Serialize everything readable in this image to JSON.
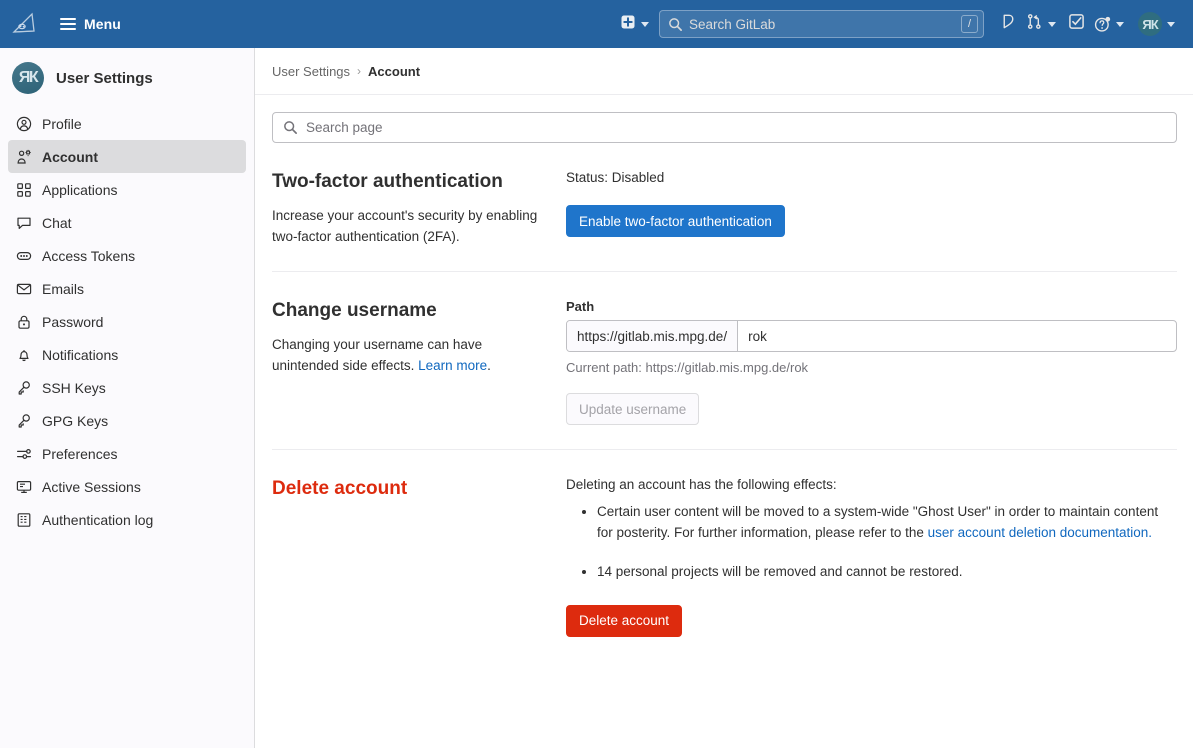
{
  "navbar": {
    "logo_icon": "gitlab-custom-logo-icon",
    "menu_label": "Menu",
    "hamburger_icon": "hamburger-menu-icon",
    "create_new_icon": "plus-square-icon",
    "search": {
      "icon": "search-icon",
      "placeholder": "Search GitLab",
      "value": "",
      "shortcut_badge": "/"
    },
    "issues_icon": "issues-icon",
    "merge_requests_icon": "merge-request-icon",
    "todos_icon": "todo-checkbox-icon",
    "help_icon": "help-question-icon",
    "avatar_initials": "ЯК",
    "avatar_color": "#2f6d80",
    "background_color": "#25629f"
  },
  "sidebar": {
    "title": "User Settings",
    "avatar_initials": "ЯК",
    "items": [
      {
        "label": "Profile",
        "icon": "user-profile-icon",
        "active": false
      },
      {
        "label": "Account",
        "icon": "user-gear-icon",
        "active": true
      },
      {
        "label": "Applications",
        "icon": "applications-grid-icon",
        "active": false
      },
      {
        "label": "Chat",
        "icon": "chat-bubble-icon",
        "active": false
      },
      {
        "label": "Access Tokens",
        "icon": "token-ellipsis-icon",
        "active": false
      },
      {
        "label": "Emails",
        "icon": "envelope-icon",
        "active": false
      },
      {
        "label": "Password",
        "icon": "lock-icon",
        "active": false
      },
      {
        "label": "Notifications",
        "icon": "bell-icon",
        "active": false
      },
      {
        "label": "SSH Keys",
        "icon": "key-icon",
        "active": false
      },
      {
        "label": "GPG Keys",
        "icon": "key-icon",
        "active": false
      },
      {
        "label": "Preferences",
        "icon": "sliders-icon",
        "active": false
      },
      {
        "label": "Active Sessions",
        "icon": "monitor-icon",
        "active": false
      },
      {
        "label": "Authentication log",
        "icon": "log-table-icon",
        "active": false
      }
    ]
  },
  "breadcrumb": {
    "parent": "User Settings",
    "separator": "›",
    "current": "Account"
  },
  "page_search": {
    "icon": "search-icon",
    "placeholder": "Search page",
    "value": ""
  },
  "sections": {
    "two_factor": {
      "title": "Two-factor authentication",
      "description": "Increase your account's security by enabling two-factor authentication (2FA).",
      "status_text": "Status: Disabled",
      "enable_button": "Enable two-factor authentication",
      "button_color": "#1f75cb"
    },
    "change_username": {
      "title": "Change username",
      "description_text": "Changing your username can have unintended side effects. ",
      "description_link": "Learn more",
      "description_tail": ".",
      "path_label": "Path",
      "path_prefix": "https://gitlab.mis.mpg.de/",
      "username_value": "rok",
      "current_path_text": "Current path: https://gitlab.mis.mpg.de/rok",
      "update_button": "Update username",
      "update_button_disabled": true
    },
    "delete_account": {
      "title": "Delete account",
      "title_color": "#dd2b0e",
      "intro": "Deleting an account has the following effects:",
      "effects": [
        {
          "text_before": "Certain user content will be moved to a system-wide \"Ghost User\" in order to maintain content for posterity. For further information, please refer to the ",
          "link_text": "user account deletion documentation.",
          "text_after": ""
        },
        {
          "text_before": "14 personal projects will be removed and cannot be restored.",
          "link_text": "",
          "text_after": ""
        }
      ],
      "delete_button": "Delete account",
      "button_color": "#dd2b0e"
    }
  }
}
